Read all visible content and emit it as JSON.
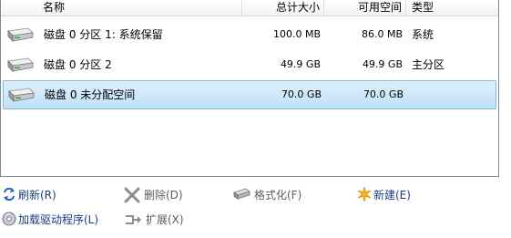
{
  "columns": {
    "name": "名称",
    "total": "总计大小",
    "free": "可用空间",
    "type": "类型"
  },
  "partitions": [
    {
      "name": "磁盘 0 分区 1: 系统保留",
      "total": "100.0 MB",
      "free": "86.0 MB",
      "type": "系统",
      "selected": false
    },
    {
      "name": "磁盘 0 分区 2",
      "total": "49.9 GB",
      "free": "49.9 GB",
      "type": "主分区",
      "selected": false
    },
    {
      "name": "磁盘 0 未分配空间",
      "total": "70.0 GB",
      "free": "70.0 GB",
      "type": "",
      "selected": true
    }
  ],
  "actions": {
    "refresh": "刷新(R)",
    "delete": "删除(D)",
    "format": "格式化(F)",
    "new": "新建(E)",
    "load_driver": "加载驱动程序(L)",
    "extend": "扩展(X)"
  },
  "icons": {
    "disk": "disk-drive-icon",
    "refresh": "refresh-icon",
    "delete": "delete-x-icon",
    "format": "format-drive-icon",
    "new": "new-starburst-icon",
    "load_driver": "cd-disc-icon",
    "extend": "extend-icon"
  },
  "colors": {
    "selection_fill": "#cce8fa",
    "selection_border": "#7fbde8",
    "link": "#1a3e7a",
    "disabled": "#5c5c5c"
  }
}
